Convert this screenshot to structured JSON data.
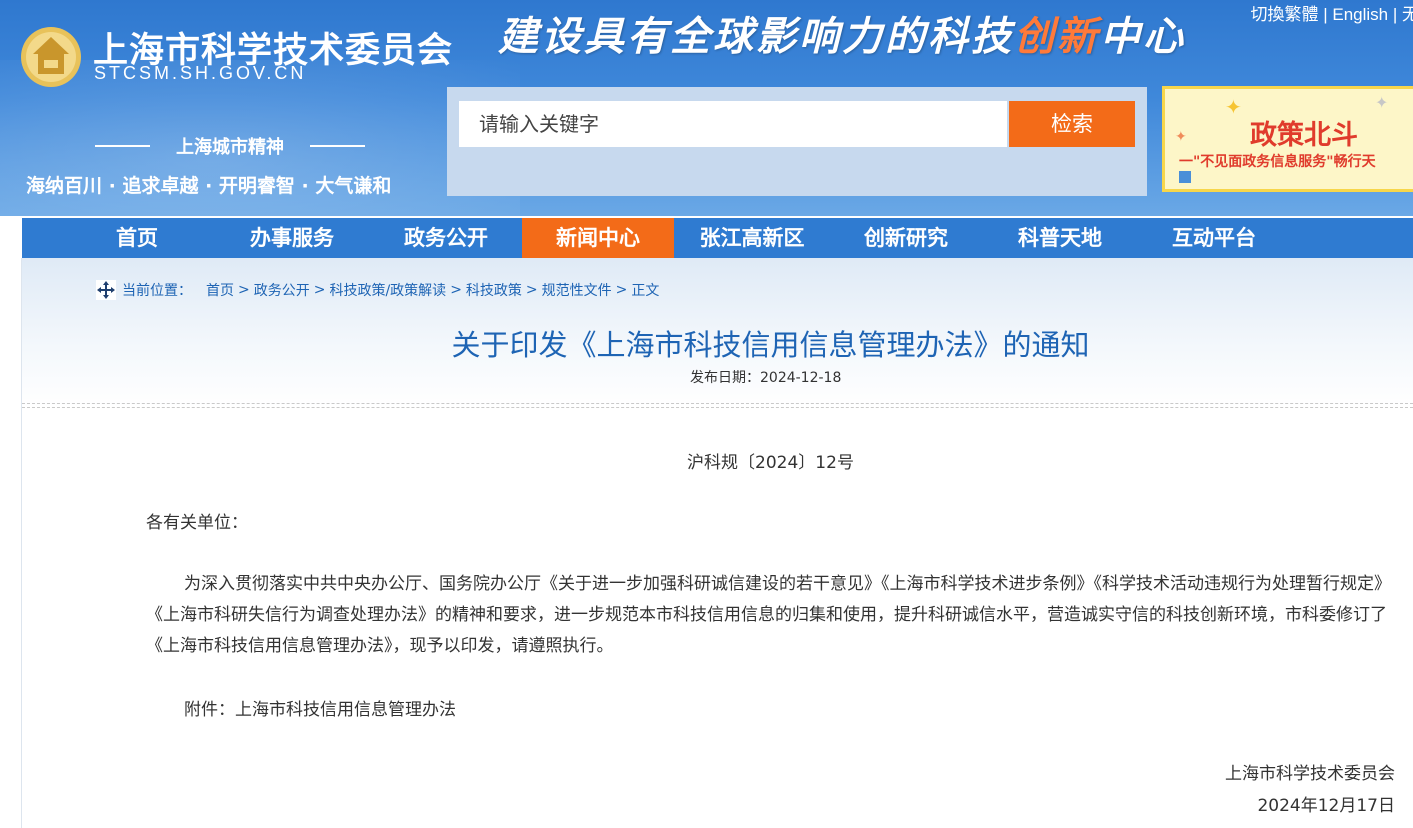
{
  "header": {
    "site_name": "上海市科学技术委员会",
    "site_domain": "STCSM.SH.GOV.CN",
    "slogan_main": "建设具有全球影响力的科技",
    "slogan_highlight": "创新",
    "slogan_tail": "中心",
    "top_links": {
      "traditional": "切換繁體",
      "sep1": " | ",
      "english": "English",
      "sep2": " | ",
      "accessibility": "无"
    },
    "spirit_title": "上海城市精神",
    "spirit_text": "海纳百川 · 追求卓越 · 开明睿智 · 大气谦和"
  },
  "search": {
    "placeholder": "请输入关键字",
    "button_label": "检索"
  },
  "banner": {
    "title": "政策北斗",
    "subtitle": "一\"不见面政务信息服务\"畅行天"
  },
  "nav": {
    "items": [
      {
        "label": "首页"
      },
      {
        "label": "办事服务"
      },
      {
        "label": "政务公开"
      },
      {
        "label": "新闻中心"
      },
      {
        "label": "张江高新区"
      },
      {
        "label": "创新研究"
      },
      {
        "label": "科普天地"
      },
      {
        "label": "互动平台"
      }
    ],
    "active_index": 3,
    "bar_color": "#2f7bd1",
    "active_color": "#f36b18"
  },
  "breadcrumb": {
    "prefix": "当前位置：",
    "items": [
      "首页",
      "政务公开",
      "科技政策/政策解读",
      "科技政策",
      "规范性文件",
      "正文"
    ],
    "sep": ">"
  },
  "article": {
    "title": "关于印发《上海市科技信用信息管理办法》的通知",
    "pub_date_label": "发布日期：",
    "pub_date": "2024-12-18",
    "doc_no": "沪科规〔2024〕12号",
    "addressee": "各有关单位：",
    "body": "为深入贯彻落实中共中央办公厅、国务院办公厅《关于进一步加强科研诚信建设的若干意见》《上海市科学技术进步条例》《科学技术活动违规行为处理暂行规定》《上海市科研失信行为调查处理办法》的精神和要求，进一步规范本市科技信用信息的归集和使用，提升科研诚信水平，营造诚实守信的科技创新环境，市科委修订了《上海市科技信用信息管理办法》，现予以印发，请遵照执行。",
    "attachment": "附件：上海市科技信用信息管理办法",
    "sign_org": "上海市科学技术委员会",
    "sign_date": "2024年12月17日"
  }
}
